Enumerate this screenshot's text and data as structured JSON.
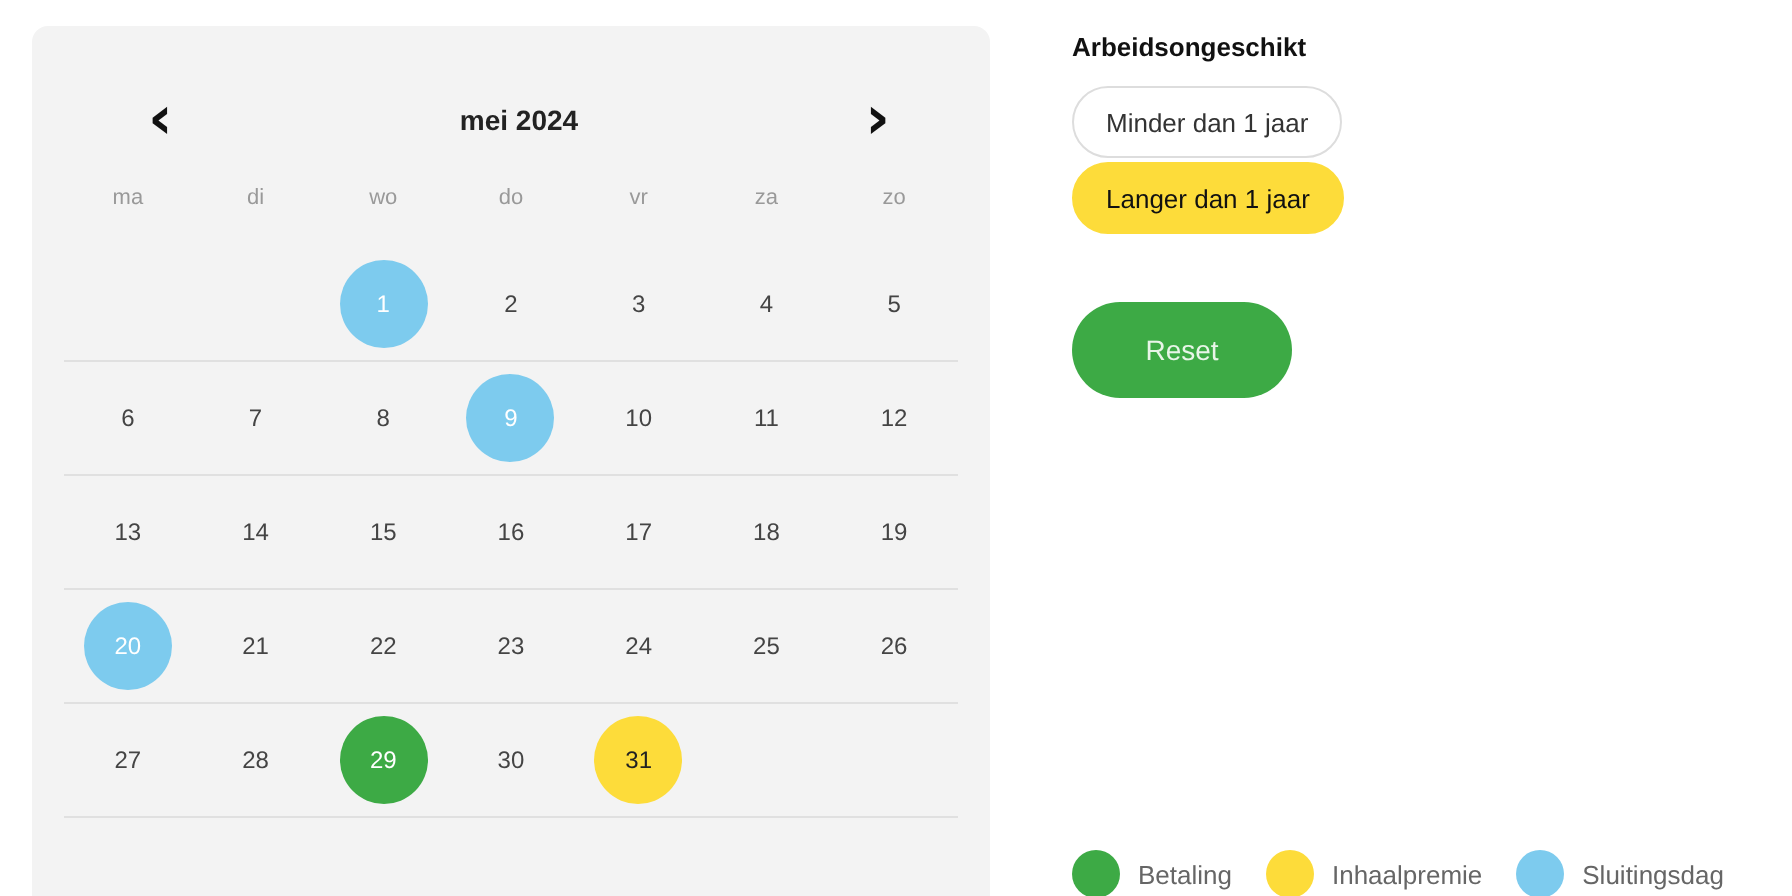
{
  "calendar": {
    "prev": "‹",
    "month": "mei 2024",
    "next": "›",
    "weekdays": [
      "ma",
      "di",
      "wo",
      "do",
      "vr",
      "za",
      "zo"
    ],
    "weeks": [
      [
        {
          "day": "1",
          "color": "#7dcbee"
        },
        {
          "day": "2"
        },
        {
          "day": "3"
        },
        {
          "day": "4"
        },
        {
          "day": "5"
        }
      ],
      [
        {
          "day": "6"
        },
        {
          "day": "7"
        },
        {
          "day": "8"
        },
        {
          "day": "9",
          "color": "#7dcbee"
        },
        {
          "day": "10"
        },
        {
          "day": "11"
        },
        {
          "day": "12"
        }
      ],
      [
        {
          "day": "13"
        },
        {
          "day": "14"
        },
        {
          "day": "15"
        },
        {
          "day": "16"
        },
        {
          "day": "17"
        },
        {
          "day": "18"
        },
        {
          "day": "19"
        }
      ],
      [
        {
          "day": "20",
          "color": "#7dcbee"
        },
        {
          "day": "21"
        },
        {
          "day": "22"
        },
        {
          "day": "23"
        },
        {
          "day": "24"
        },
        {
          "day": "25"
        },
        {
          "day": "26"
        }
      ],
      [
        {
          "day": "27"
        },
        {
          "day": "28"
        },
        {
          "day": "29",
          "color": "#3daa45"
        },
        {
          "day": "30"
        },
        {
          "day": "31",
          "color": "#fddc3a"
        }
      ]
    ]
  },
  "filter": {
    "title": "Arbeidsongeschikt",
    "options": [
      {
        "label": "Minder dan 1 jaar",
        "selected": false
      },
      {
        "label": "Langer dan 1 jaar",
        "selected": true
      }
    ],
    "reset": "Reset"
  },
  "legend": [
    {
      "label": "Betaling",
      "color": "#3daa45"
    },
    {
      "label": "Inhaalpremie",
      "color": "#fddc3a"
    },
    {
      "label": "Sluitingsdag",
      "color": "#7dcbee"
    }
  ]
}
